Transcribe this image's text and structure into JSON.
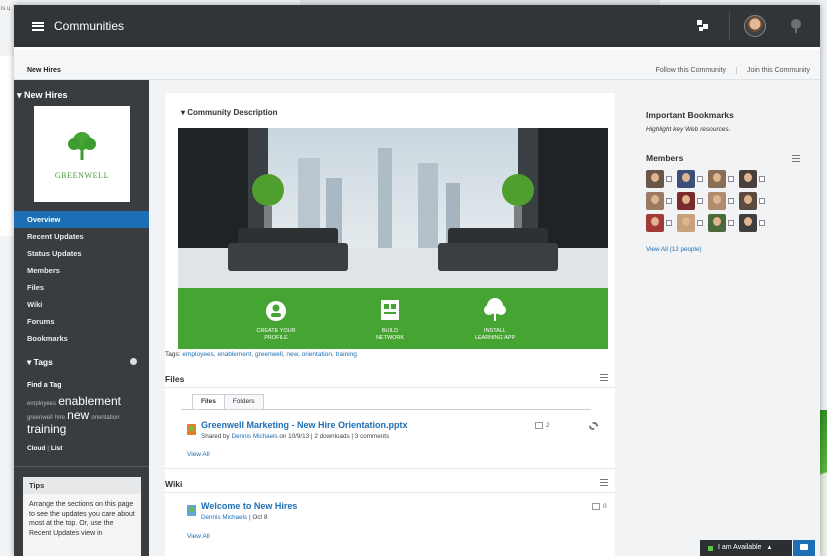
{
  "background": {
    "snippet": "is u"
  },
  "topbar": {
    "title": "Communities"
  },
  "breadcrumb": {
    "current": "New Hires",
    "follow_label": "Follow this Community",
    "join_label": "Join this Community"
  },
  "sidebar": {
    "title": "New Hires",
    "logo_text": "GREENWELL",
    "nav": [
      "Overview",
      "Recent Updates",
      "Status Updates",
      "Members",
      "Files",
      "Wiki",
      "Forums",
      "Bookmarks"
    ],
    "active_nav": "Overview",
    "tags_title": "Tags",
    "find_tag": "Find a Tag",
    "tag_cloud": {
      "employees": "employees",
      "enablement": "enablement",
      "greenwell": "greenwell",
      "hire": "hire",
      "new": "new",
      "orientation": "orientation",
      "training": "training"
    },
    "cloud_label": "Cloud",
    "list_label": "List",
    "tips_title": "Tips",
    "tips_body": "Arrange the sections on this page to see the updates you care about most at the top. Or, use the Recent Updates view in"
  },
  "main": {
    "community_description": "Community Description",
    "banner": {
      "step1_line1": "CREATE YOUR",
      "step1_line2": "PROFILE",
      "step2_line1": "BUILD",
      "step2_line2": "NETWORK",
      "step3_line1": "INSTALL",
      "step3_line2": "LEARNING APP"
    },
    "tags_prefix": "Tags:",
    "tags_list": "employees, enablement, greenwell, new, orientation, training",
    "files": {
      "title": "Files",
      "tabs": [
        "Files",
        "Folders"
      ],
      "item_title": "Greenwell Marketing - New Hire Orientation.pptx",
      "shared_by": "Shared by",
      "author": "Dennis Michaels",
      "meta": "on 10/9/13  |  2 downloads  |  3 comments",
      "count": "2",
      "view_all": "View All"
    },
    "wiki": {
      "title": "Wiki",
      "item_title": "Welcome to New Hires",
      "author": "Dennis Michaels",
      "meta": "|  Oct 8",
      "count": "0",
      "view_all": "View All"
    }
  },
  "right": {
    "bookmarks_title": "Important Bookmarks",
    "bookmarks_sub": "Highlight key Web resources.",
    "members_title": "Members",
    "member_colors": [
      "#6b5547",
      "#3c4f78",
      "#8a6e56",
      "#4a3f3a",
      "#9a7a62",
      "#7c2b2b",
      "#b08c6e",
      "#5a4a40",
      "#a33a3a",
      "#c7a07c",
      "#4b6a3e",
      "#3e3e3e"
    ],
    "view_all": "View All (12 people)"
  },
  "status": {
    "available": "I am Available"
  },
  "colors": {
    "accent": "#1d6fb5",
    "brand_green": "#46a432",
    "topbar": "#323538",
    "sidebar": "#3a3d40"
  }
}
